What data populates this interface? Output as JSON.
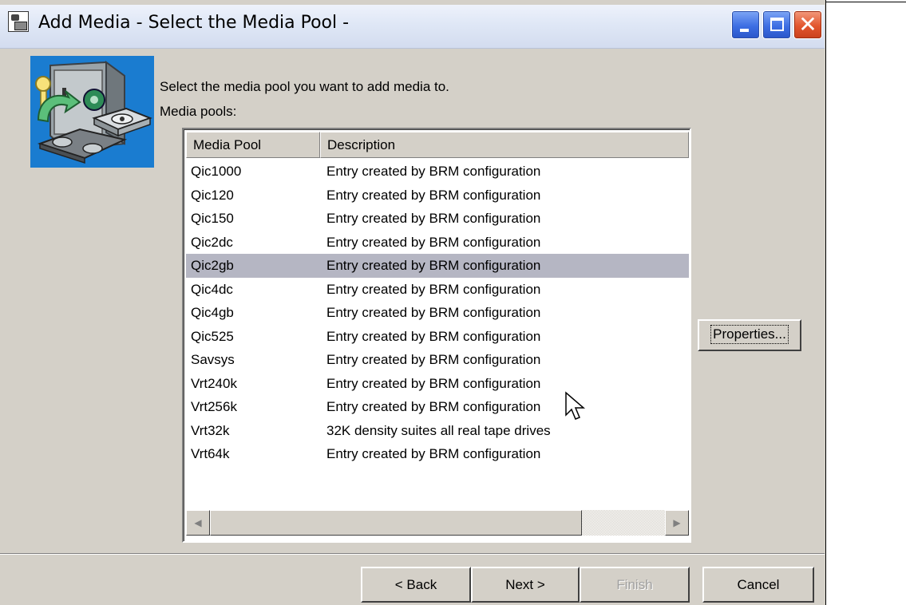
{
  "window": {
    "title": "Add Media - Select the Media Pool -",
    "controls": {
      "minimize": "minimize",
      "maximize": "maximize",
      "close": "✕"
    }
  },
  "main": {
    "prompt": "Select the media pool you want to add media to.",
    "list_label": "Media pools:"
  },
  "table": {
    "columns": [
      "Media Pool",
      "Description"
    ],
    "rows": [
      {
        "pool": "Qic1000",
        "description": "Entry created by BRM configuration"
      },
      {
        "pool": "Qic120",
        "description": "Entry created by BRM configuration"
      },
      {
        "pool": "Qic150",
        "description": "Entry created by BRM configuration"
      },
      {
        "pool": "Qic2dc",
        "description": "Entry created by BRM configuration"
      },
      {
        "pool": "Qic2gb",
        "description": "Entry created by BRM configuration"
      },
      {
        "pool": "Qic4dc",
        "description": "Entry created by BRM configuration"
      },
      {
        "pool": "Qic4gb",
        "description": "Entry created by BRM configuration"
      },
      {
        "pool": "Qic525",
        "description": "Entry created by BRM configuration"
      },
      {
        "pool": "Savsys",
        "description": "Entry created by BRM configuration"
      },
      {
        "pool": "Vrt240k",
        "description": "Entry created by BRM configuration"
      },
      {
        "pool": "Vrt256k",
        "description": "Entry created by BRM configuration"
      },
      {
        "pool": "Vrt32k",
        "description": "32K density suites all real tape drives"
      },
      {
        "pool": "Vrt64k",
        "description": "Entry created by BRM configuration"
      }
    ],
    "selected_pool": "Qic2gb"
  },
  "buttons": {
    "properties": "Properties...",
    "back": "< Back",
    "next": "Next >",
    "finish": "Finish",
    "cancel": "Cancel"
  },
  "icons": {
    "window_icon": "system-app-icon",
    "wizard_image": "safe-with-disks-icon",
    "scroll_left": "left-arrow-icon",
    "scroll_right": "right-arrow-icon",
    "pointer": "mouse-cursor-icon"
  },
  "colors": {
    "selection": "#b5b6c3",
    "dialog_background": "#d4d0c8",
    "close_button": "#e2562e",
    "title_buttons": "#3d6ee3"
  }
}
